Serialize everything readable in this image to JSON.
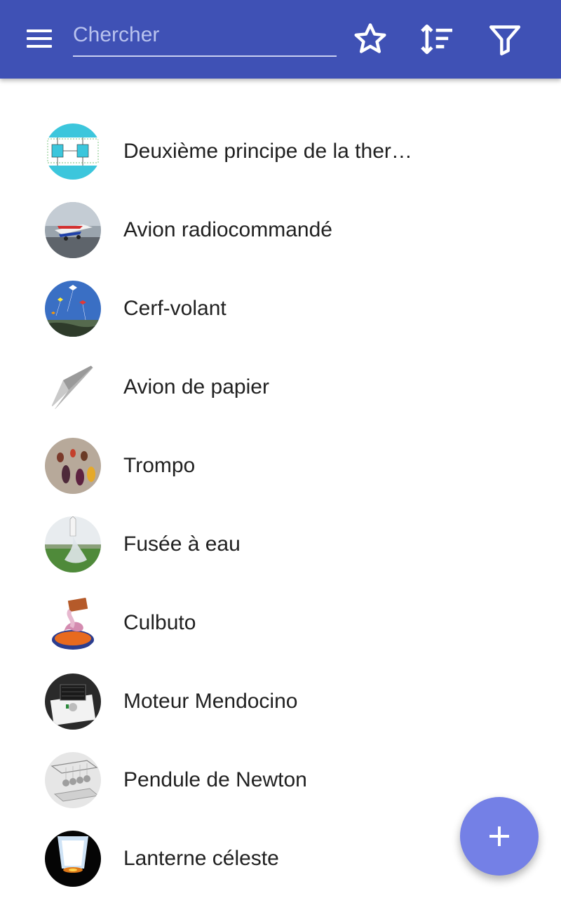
{
  "toolbar": {
    "search_placeholder": "Chercher",
    "icons": [
      "menu-icon",
      "star-icon",
      "sort-icon",
      "filter-icon"
    ]
  },
  "colors": {
    "appbar": "#3f51b5",
    "fab": "#7480e6",
    "text": "#212121"
  },
  "items": [
    {
      "label": "Deuxième principe de la ther…",
      "thumb": "thermodynamics-diagram"
    },
    {
      "label": "Avion radiocommandé",
      "thumb": "rc-airplane-photo"
    },
    {
      "label": "Cerf-volant",
      "thumb": "kites-sky-photo"
    },
    {
      "label": "Avion de papier",
      "thumb": "paper-airplane-photo"
    },
    {
      "label": "Trompo",
      "thumb": "spinning-tops-photo"
    },
    {
      "label": "Fusée à eau",
      "thumb": "water-rocket-photo"
    },
    {
      "label": "Culbuto",
      "thumb": "roly-poly-toy-photo"
    },
    {
      "label": "Moteur Mendocino",
      "thumb": "mendocino-motor-photo"
    },
    {
      "label": "Pendule de Newton",
      "thumb": "newtons-cradle-photo"
    },
    {
      "label": "Lanterne céleste",
      "thumb": "sky-lantern-photo"
    }
  ],
  "fab": {
    "icon": "plus-icon"
  }
}
